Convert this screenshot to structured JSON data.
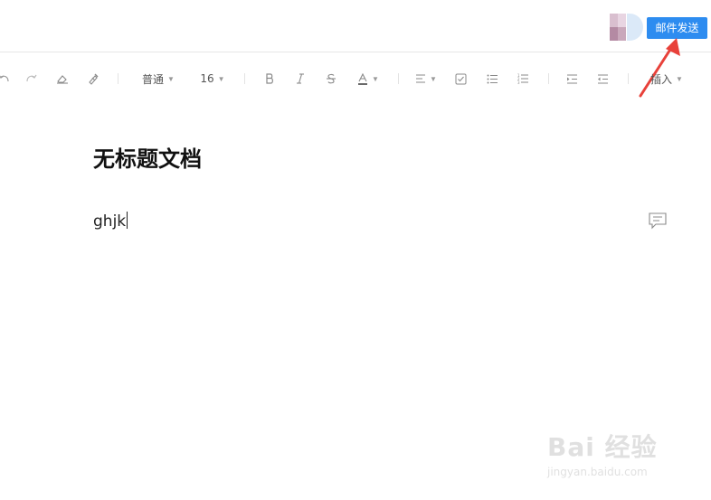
{
  "header": {
    "send_button_label": "邮件发送"
  },
  "toolbar": {
    "paragraph_style": "普通",
    "font_size": "16",
    "insert_label": "插入"
  },
  "document": {
    "title": "无标题文档",
    "body": "ghjk"
  },
  "watermark": {
    "logo": "Bai 经验",
    "url": "jingyan.baidu.com"
  },
  "colors": {
    "accent": "#2d8cf0",
    "annotation_arrow": "#e8413a"
  }
}
